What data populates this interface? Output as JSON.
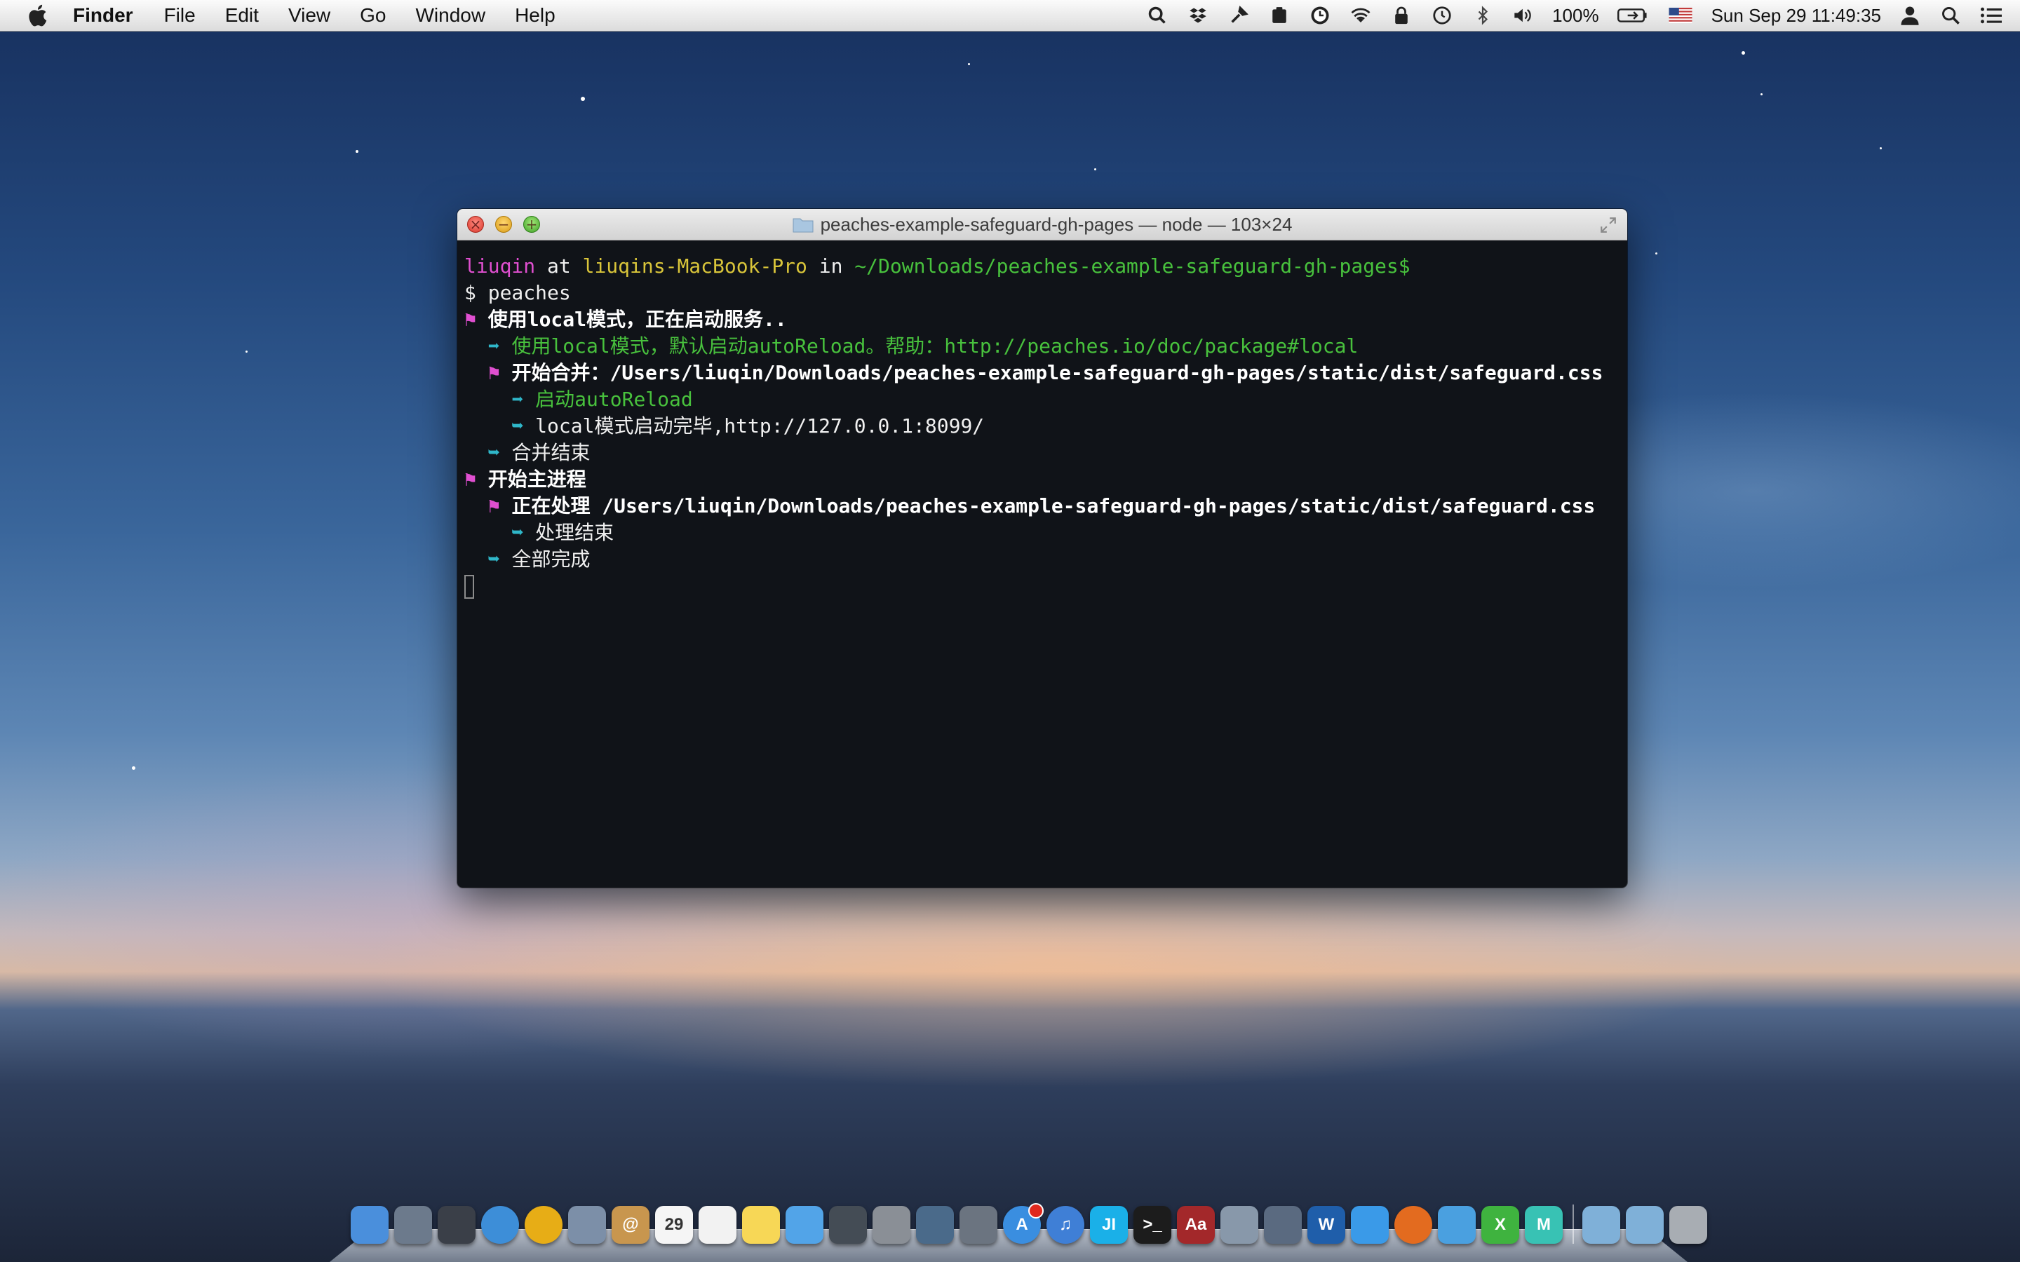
{
  "menubar": {
    "app_name": "Finder",
    "menus": [
      "File",
      "Edit",
      "View",
      "Go",
      "Window",
      "Help"
    ],
    "battery": "100%",
    "clock": "Sun Sep 29  11:49:35"
  },
  "terminal": {
    "title": "peaches-example-safeguard-gh-pages — node — 103×24",
    "prompt": {
      "user": "liuqin",
      "at": " at ",
      "host": "liuqins-MacBook-Pro",
      "in": " in ",
      "path": "~/Downloads/peaches-example-safeguard-gh-pages$"
    },
    "command": "$ peaches",
    "lines": [
      {
        "indent": "",
        "glyph": "⚑",
        "glyph_class": "pink",
        "text": "使用local模式，正在启动服务..",
        "text_class": "white-b"
      },
      {
        "indent": "  ",
        "glyph": "➡",
        "glyph_class": "cyan",
        "text": "使用local模式，默认启动autoReload。帮助：http://peaches.io/doc/package#local",
        "text_class": "green"
      },
      {
        "indent": "  ",
        "glyph": "⚑",
        "glyph_class": "pink",
        "text": "开始合并：/Users/liuqin/Downloads/peaches-example-safeguard-gh-pages/static/dist/safeguard.css",
        "text_class": "white-b"
      },
      {
        "indent": "    ",
        "glyph": "➡",
        "glyph_class": "cyan",
        "text": "启动autoReload",
        "text_class": "green"
      },
      {
        "indent": "    ",
        "glyph": "➥",
        "glyph_class": "cyan",
        "text": "local模式启动完毕,http://127.0.0.1:8099/",
        "text_class": "white"
      },
      {
        "indent": "  ",
        "glyph": "➥",
        "glyph_class": "cyan",
        "text": "合并结束",
        "text_class": "white"
      },
      {
        "indent": "",
        "glyph": "⚑",
        "glyph_class": "pink",
        "text": "开始主进程",
        "text_class": "white-b"
      },
      {
        "indent": "  ",
        "glyph": "⚑",
        "glyph_class": "pink",
        "text": "正在处理 /Users/liuqin/Downloads/peaches-example-safeguard-gh-pages/static/dist/safeguard.css",
        "text_class": "white-b"
      },
      {
        "indent": "    ",
        "glyph": "➥",
        "glyph_class": "cyan",
        "text": "处理结束",
        "text_class": "white"
      },
      {
        "indent": "  ",
        "glyph": "➥",
        "glyph_class": "cyan",
        "text": "全部完成",
        "text_class": "white"
      }
    ]
  },
  "dock": {
    "calendar_day": "29",
    "apps": [
      {
        "name": "finder",
        "color": "#4a8fdc",
        "label": ""
      },
      {
        "name": "launchpad",
        "color": "#6c7a8c",
        "label": ""
      },
      {
        "name": "mission-control",
        "color": "#3a3f48",
        "label": ""
      },
      {
        "name": "safari",
        "color": "#3d8ed8",
        "label": ""
      },
      {
        "name": "chrome",
        "color": "#e7ad16",
        "label": ""
      },
      {
        "name": "preview",
        "color": "#7c8fa8",
        "label": ""
      },
      {
        "name": "contacts",
        "color": "#c8964e",
        "label": "@"
      },
      {
        "name": "calendar",
        "color": "#f5f5f5",
        "label": "29"
      },
      {
        "name": "reminders",
        "color": "#f2f2f2",
        "label": ""
      },
      {
        "name": "notes",
        "color": "#f7d756",
        "label": ""
      },
      {
        "name": "messages",
        "color": "#52a4e8",
        "label": ""
      },
      {
        "name": "facetime",
        "color": "#444c55",
        "label": ""
      },
      {
        "name": "system-preferences",
        "color": "#8a8f96",
        "label": ""
      },
      {
        "name": "iphoto",
        "color": "#4a6a8a",
        "label": ""
      },
      {
        "name": "image-capture",
        "color": "#6b7480",
        "label": ""
      },
      {
        "name": "app-store",
        "color": "#3a8ee0",
        "label": "A"
      },
      {
        "name": "itunes",
        "color": "#3f7fd6",
        "label": "♫"
      },
      {
        "name": "webstorm",
        "color": "#1ab0e8",
        "label": "JI"
      },
      {
        "name": "terminal",
        "color": "#1c1c1c",
        "label": ">_"
      },
      {
        "name": "dictionary",
        "color": "#a3282a",
        "label": "Aa"
      },
      {
        "name": "preview-photos",
        "color": "#8898aa",
        "label": ""
      },
      {
        "name": "script-editor",
        "color": "#5a6a80",
        "label": ""
      },
      {
        "name": "wunderlist",
        "color": "#1f5eaa",
        "label": "W"
      },
      {
        "name": "twitter-bird",
        "color": "#3a9ae8",
        "label": ""
      },
      {
        "name": "firefox",
        "color": "#e36b1f",
        "label": ""
      },
      {
        "name": "tweetbot",
        "color": "#4aa0e0",
        "label": ""
      },
      {
        "name": "x-app",
        "color": "#3fb33f",
        "label": "X"
      },
      {
        "name": "m-app",
        "color": "#38c2b4",
        "label": "M"
      },
      {
        "name": "applications-folder",
        "color": "#7fb0d8",
        "label": ""
      },
      {
        "name": "downloads-folder",
        "color": "#7fb0d8",
        "label": ""
      },
      {
        "name": "trash",
        "color": "#a8adb3",
        "label": ""
      }
    ]
  }
}
